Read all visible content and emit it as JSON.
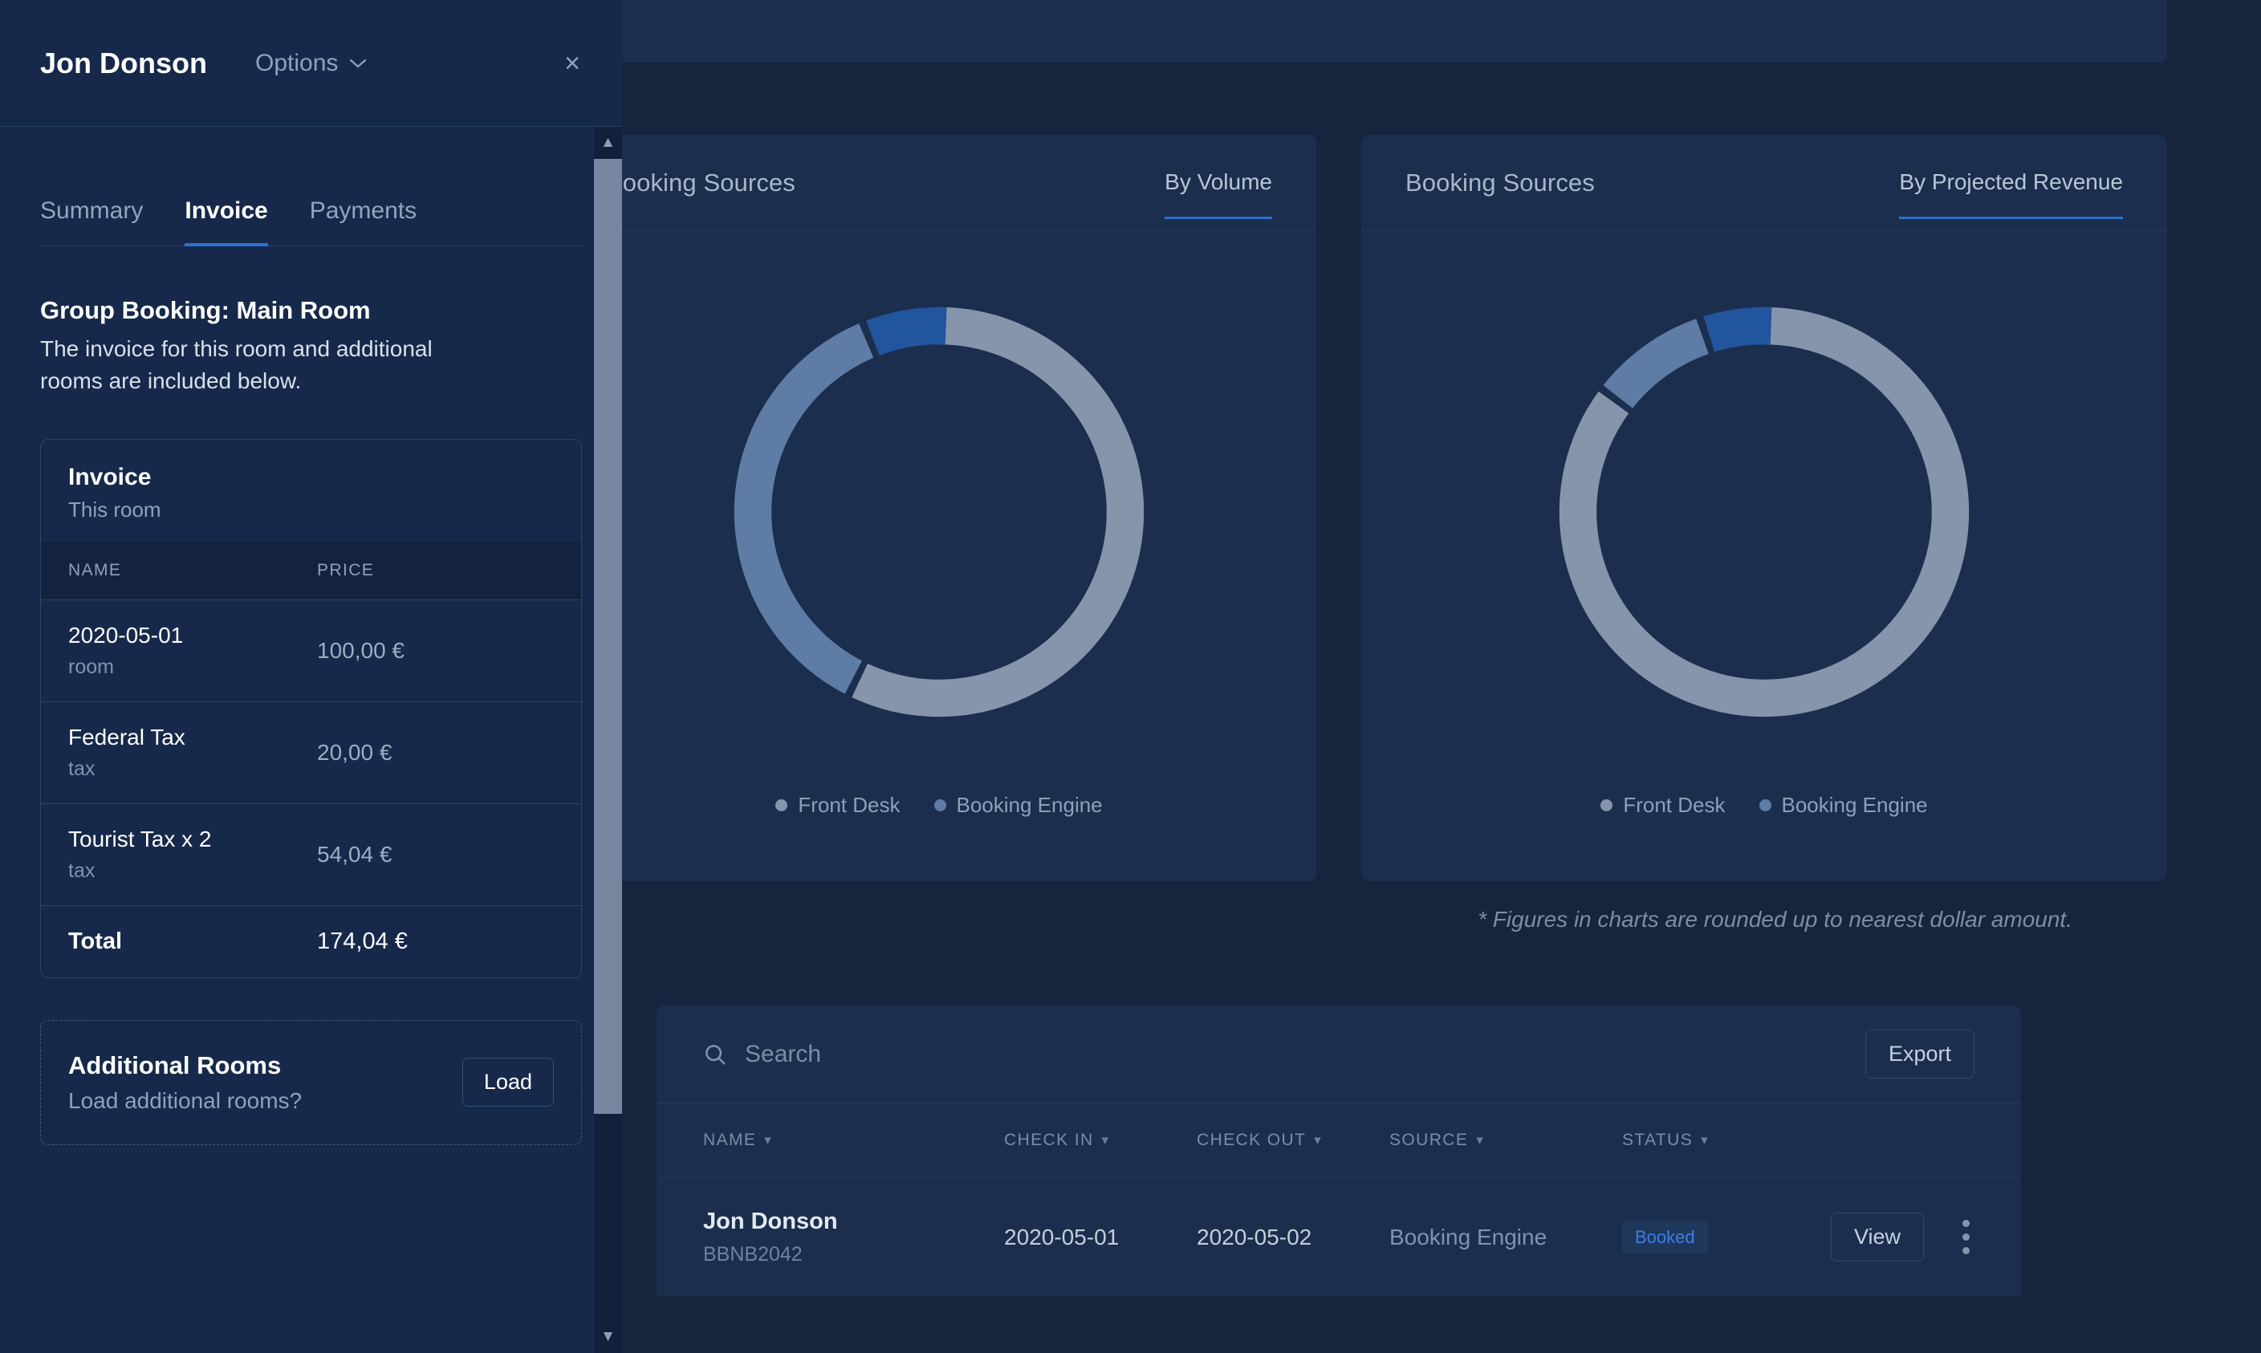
{
  "background": {
    "charts": [
      {
        "title": "Booking Sources",
        "toggle": "By Volume",
        "legend": [
          {
            "label": "Front Desk",
            "color": "#8695ab"
          },
          {
            "label": "Booking Engine",
            "color": "#5e7ca5"
          }
        ]
      },
      {
        "title": "Booking Sources",
        "toggle": "By Projected Revenue",
        "legend": [
          {
            "label": "Front Desk",
            "color": "#8695ab"
          },
          {
            "label": "Booking Engine",
            "color": "#5e7ca5"
          }
        ]
      }
    ],
    "chart_note": "* Figures in charts are rounded up to nearest dollar amount.",
    "bookings": {
      "search_placeholder": "Search",
      "search_value": "",
      "export_label": "Export",
      "columns": [
        "NAME",
        "CHECK IN",
        "CHECK OUT",
        "SOURCE",
        "STATUS"
      ],
      "rows": [
        {
          "name": "Jon Donson",
          "reference": "BBNB2042",
          "check_in": "2020-05-01",
          "check_out": "2020-05-02",
          "source": "Booking Engine",
          "status": "Booked",
          "view_label": "View"
        }
      ]
    }
  },
  "drawer": {
    "title": "Jon Donson",
    "options_label": "Options",
    "close_label": "×",
    "tabs": [
      {
        "label": "Summary",
        "active": false
      },
      {
        "label": "Invoice",
        "active": true
      },
      {
        "label": "Payments",
        "active": false
      }
    ],
    "section": {
      "title": "Group Booking: Main Room",
      "description": "The invoice for this room and additional rooms are included below."
    },
    "invoice": {
      "heading": "Invoice",
      "subheading": "This room",
      "columns": [
        "NAME",
        "PRICE"
      ],
      "lines": [
        {
          "name": "2020-05-01",
          "type": "room",
          "price": "100,00 €"
        },
        {
          "name": "Federal Tax",
          "type": "tax",
          "price": "20,00 €"
        },
        {
          "name": "Tourist Tax x 2",
          "type": "tax",
          "price": "54,04 €"
        }
      ],
      "total_label": "Total",
      "total_price": "174,04 €"
    },
    "additional_rooms": {
      "title": "Additional Rooms",
      "subtitle": "Load additional rooms?",
      "button_label": "Load"
    }
  },
  "chart_data": [
    {
      "type": "pie",
      "title": "Booking Sources",
      "subtitle": "By Volume",
      "donut": true,
      "labels": [
        "Front Desk",
        "Booking Engine",
        "Booking Engine (highlight)"
      ],
      "values": [
        57,
        36,
        7
      ],
      "colors": [
        "#8695ab",
        "#5e7ca5",
        "#21559e"
      ],
      "legend": [
        "Front Desk",
        "Booking Engine"
      ],
      "legend_position": "bottom",
      "start_angle": 0
    },
    {
      "type": "pie",
      "title": "Booking Sources",
      "subtitle": "By Projected Revenue",
      "donut": true,
      "labels": [
        "Front Desk",
        "Booking Engine",
        "Booking Engine (highlight)"
      ],
      "values": [
        85,
        9,
        6
      ],
      "colors": [
        "#8695ab",
        "#5e7ca5",
        "#21559e"
      ],
      "legend": [
        "Front Desk",
        "Booking Engine"
      ],
      "legend_position": "bottom",
      "start_angle": 0
    }
  ]
}
